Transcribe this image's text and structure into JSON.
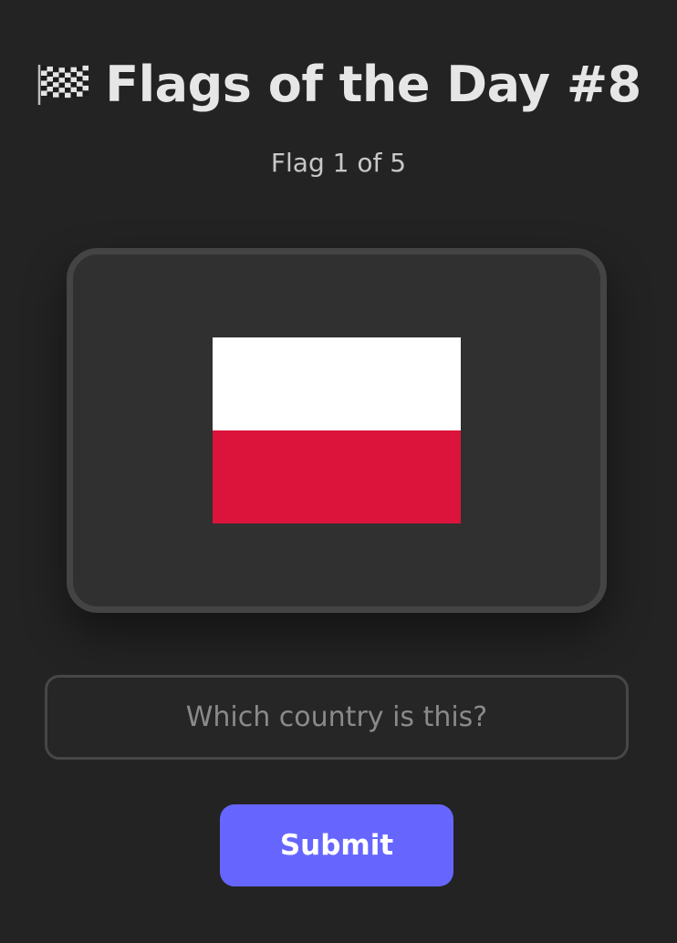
{
  "header": {
    "icon": "checkered-flag-icon",
    "title": "Flags of the Day #8"
  },
  "progress": {
    "text": "Flag 1 of 5"
  },
  "flag_card": {
    "stripes": [
      "#ffffff",
      "#dc143c"
    ]
  },
  "guess": {
    "value": "",
    "placeholder": "Which country is this?"
  },
  "submit": {
    "label": "Submit",
    "color": "#6666ff"
  }
}
